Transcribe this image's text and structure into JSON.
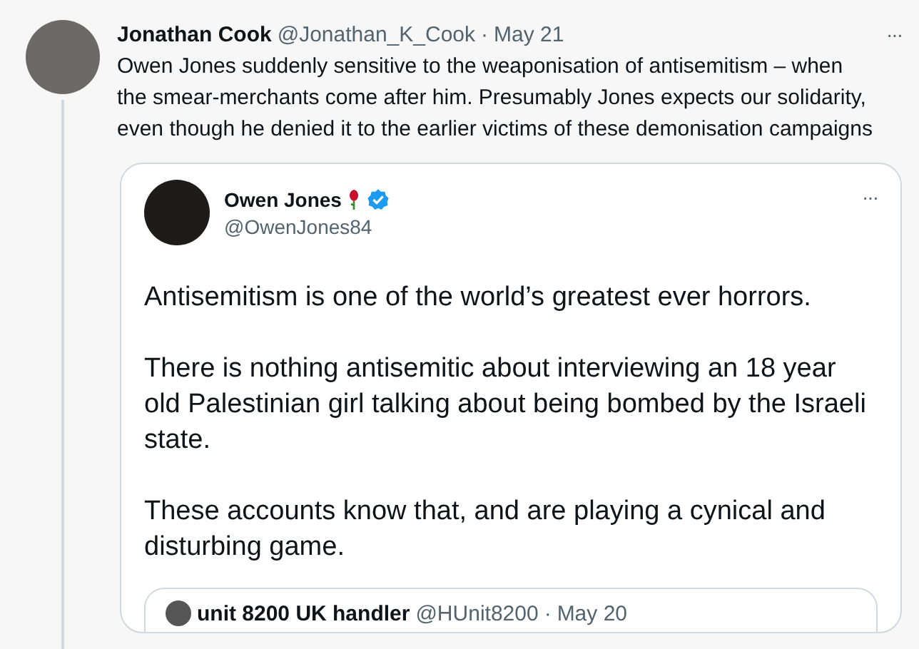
{
  "tweet": {
    "author": "Jonathan Cook",
    "handle": "@Jonathan_K_Cook",
    "separator": "·",
    "date": "May 21",
    "text": "Owen Jones suddenly sensitive to the weaponisation of antisemitism – when the smear-merchants come after him. Presumably Jones expects our solidarity, even though he denied it to the earlier victims of these demonisation campaigns",
    "menu": "···"
  },
  "quoted": {
    "author": "Owen Jones",
    "verified": true,
    "handle": "@OwenJones84",
    "menu": "···",
    "paragraphs": [
      "Antisemitism is one of the world’s greatest ever horrors.",
      "There is nothing antisemitic about interviewing an 18 year old Palestinian girl talking about being bombed by the Israeli state.",
      "These accounts know that, and are playing a cynical and disturbing game."
    ],
    "nested_quote": {
      "author": "unit 8200 UK handler",
      "handle": "@HUnit8200",
      "separator": "·",
      "date": "May 20"
    }
  }
}
